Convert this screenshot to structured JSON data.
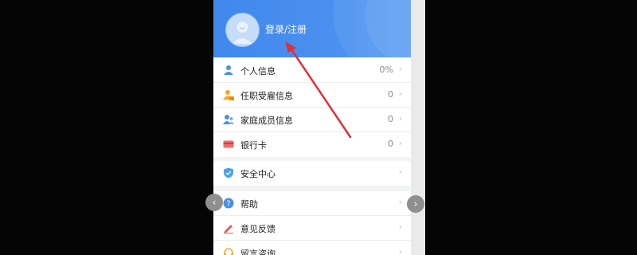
{
  "header": {
    "login_label": "登录/注册"
  },
  "menu_group_1": [
    {
      "label": "个人信息",
      "value": "0%",
      "icon": "person-icon",
      "color": "#4a90e2"
    },
    {
      "label": "任职受雇信息",
      "value": "0",
      "icon": "person-briefcase-icon",
      "color": "#f5a623"
    },
    {
      "label": "家庭成员信息",
      "value": "0",
      "icon": "family-icon",
      "color": "#4a90e2"
    },
    {
      "label": "银行卡",
      "value": "0",
      "icon": "bank-card-icon",
      "color": "#f06b6b"
    }
  ],
  "menu_group_2": [
    {
      "label": "安全中心",
      "icon": "shield-icon",
      "color": "#4aa3f0"
    }
  ],
  "menu_group_3": [
    {
      "label": "帮助",
      "icon": "question-icon",
      "color": "#4a90e2"
    },
    {
      "label": "意见反馈",
      "icon": "pen-icon",
      "color": "#f05a5a"
    },
    {
      "label": "留言咨询",
      "icon": "headset-icon",
      "color": "#f5a623"
    }
  ],
  "chevron": "›",
  "nav": {
    "prev": "‹",
    "next": "›"
  },
  "colors": {
    "header_blue": "#4b90f0",
    "annotation_arrow": "#e0303a",
    "background": "#050505"
  }
}
